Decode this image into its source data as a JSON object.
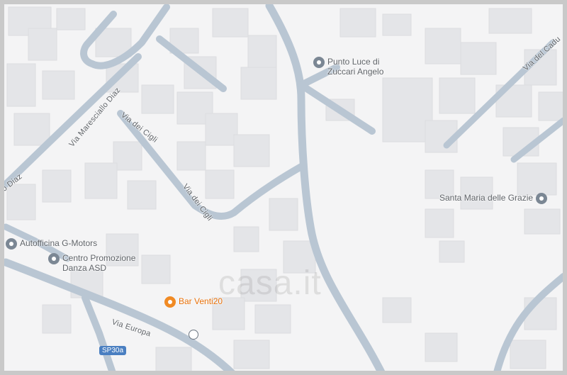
{
  "map": {
    "pois": [
      {
        "name": "Punto Luce di\nZuccari Angelo",
        "icon": "place-pin-icon"
      },
      {
        "name": "Santa Maria delle Grazie",
        "icon": "place-pin-icon"
      },
      {
        "name": "Autofficina G-Motors",
        "icon": "place-pin-icon"
      },
      {
        "name": "Centro Promozione\nDanza ASD",
        "icon": "place-pin-icon"
      },
      {
        "name": "Bar Venti20",
        "icon": "bar-cocktail-icon",
        "color": "#e8710a"
      }
    ],
    "streets": {
      "maresciallo": "Via Maresciallo Diaz",
      "diaz": "o Diaz",
      "cigli_1": "Via dei Cigli",
      "cigli_2": "Via dei Cigli",
      "europa": "Via Europa",
      "cadu": "Via del Cadu"
    },
    "road_shield": "SP30a",
    "watermark": "casa.it",
    "colors": {
      "background": "#f4f4f5",
      "road": "#b9c6d3",
      "building": "#e4e5e8"
    }
  }
}
